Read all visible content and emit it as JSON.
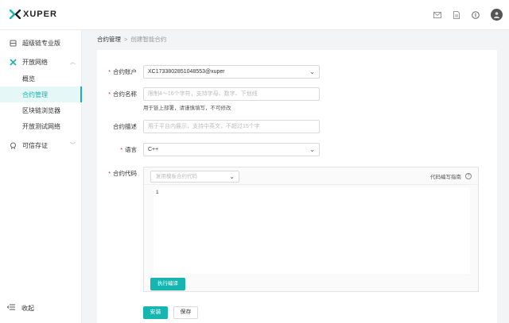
{
  "app": {
    "logo_text": "XUPER",
    "brand_color": "#17b5b0"
  },
  "topbar": {
    "icons": [
      "mail-icon",
      "document-icon",
      "coin-icon",
      "user-avatar"
    ]
  },
  "sidebar": {
    "items": [
      {
        "label": "超级链专业版",
        "icon": "grid-icon"
      },
      {
        "label": "开放网络",
        "icon": "network-icon"
      },
      {
        "label": "概览"
      },
      {
        "label": "合约管理"
      },
      {
        "label": "区块链浏览器"
      },
      {
        "label": "开放测试网络"
      },
      {
        "label": "可信存证",
        "icon": "certificate-icon"
      }
    ],
    "collapse_label": "收起"
  },
  "breadcrumb": {
    "parent": "合约管理",
    "separator": ">",
    "current": "创建智能合约"
  },
  "form": {
    "account": {
      "label": "合约账户",
      "value": "XC1733802851048553@xuper"
    },
    "name": {
      "label": "合约名称",
      "placeholder": "限制4～16个字符，支持字母、数字、下划线",
      "hint": "用于链上部署，请谨慎填写，不可修改"
    },
    "description": {
      "label": "合约描述",
      "placeholder": "用于平台内展示，支持中英文，不超过15个字"
    },
    "language": {
      "label": "语言",
      "value": "C++"
    },
    "code": {
      "label": "合约代码",
      "template_placeholder": "复用模板合约代码",
      "guide_label": "代码编写指南",
      "line_number": "1",
      "compile_label": "执行编译"
    },
    "install_label": "安装",
    "save_label": "保存"
  }
}
